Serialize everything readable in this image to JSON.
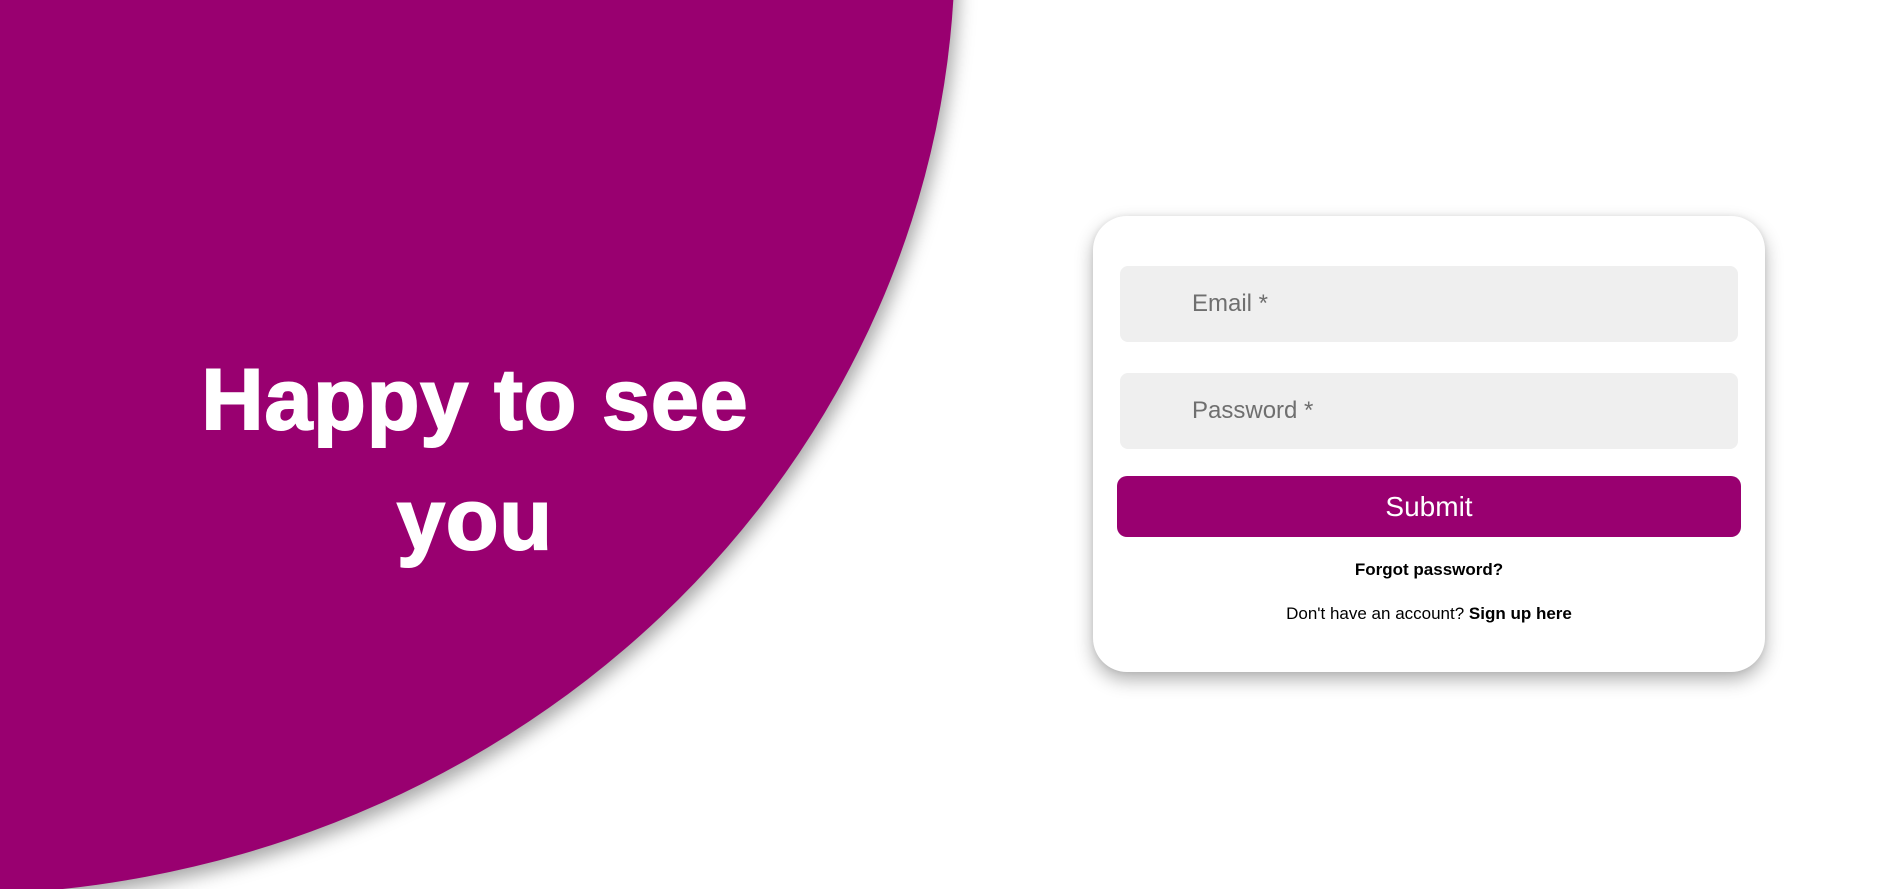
{
  "theme": {
    "accent": "#990070"
  },
  "hero": {
    "heading": "Happy to see you"
  },
  "login": {
    "email_placeholder": "Email *",
    "password_placeholder": "Password *",
    "submit_label": "Submit",
    "forgot_password_label": "Forgot password?",
    "signup_prompt": "Don't have an account?",
    "signup_link_label": "Sign up here"
  }
}
